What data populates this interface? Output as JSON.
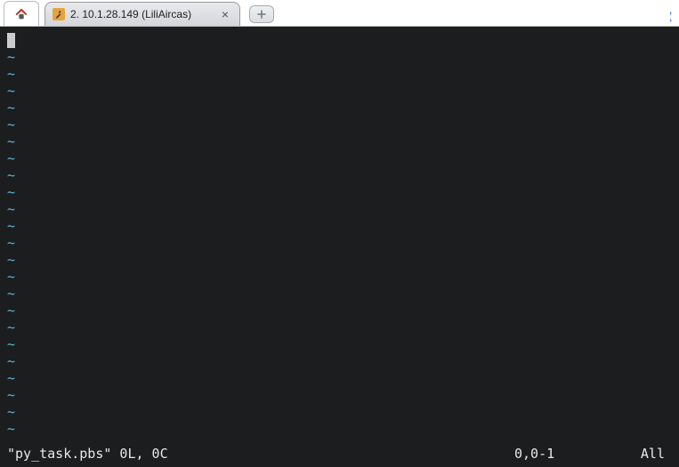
{
  "tabs": {
    "active": {
      "label": "2. 10.1.28.149 (LiliAircas)"
    }
  },
  "editor": {
    "tilde": "~",
    "tilde_count": 23
  },
  "status": {
    "file_info": "\"py_task.pbs\" 0L, 0C",
    "position": "0,0-1",
    "view": "All"
  },
  "colors": {
    "terminal_bg": "#1b1d1e",
    "tilde": "#5fb3d9"
  }
}
